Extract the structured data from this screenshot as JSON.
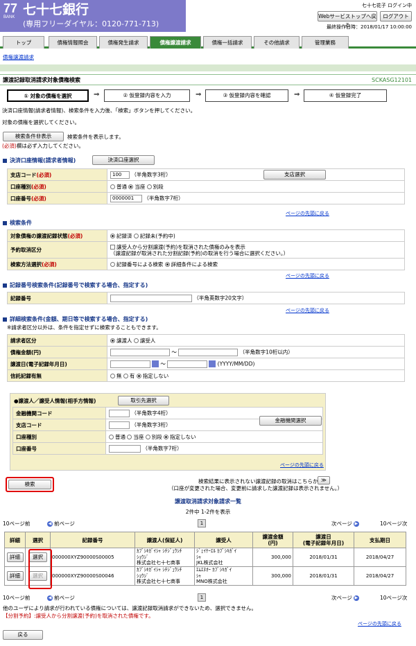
{
  "header": {
    "logo": "77",
    "logo_sub": "BANK",
    "bank_name": "七十七銀行",
    "free_dial": "(専用フリーダイヤル：0120-771-713)",
    "user": "七十七花子 ログイン中",
    "btn_top": "Webサービストップへ戻る",
    "btn_logout": "ログアウト",
    "last_op": "最終操作日時：2018/01/17 10:00:00"
  },
  "tabs": [
    "トップ",
    "債権情報照会",
    "債権発生請求",
    "債権譲渡請求",
    "債権一括請求",
    "その他請求",
    "管理業務"
  ],
  "subnav": "債権譲渡請求",
  "title": "譲渡記録取消請求対象債権検索",
  "title_code": "SCKASG12101",
  "steps": [
    "① 対象の債権を選択",
    "② 仮登録内容を入力",
    "③ 仮登録内容を確認",
    "④ 仮登録完了"
  ],
  "arrow": "⇒",
  "intro1": "決済口座情報(請求者情報)、検索条件を入力後、「検索」ボタンを押してください。",
  "intro2": "対象の債権を選択してください。",
  "btn_hide_cond": "検索条件非表示",
  "hide_cond_note": "検索条件を表示します。",
  "required_mark": "(必須)",
  "required_note": "欄は必ず入力してください。",
  "sec1": {
    "title": "決済口座情報(請求者情報)",
    "btn": "決済口座選択",
    "branch_lbl": "支店コード",
    "branch_val": "100",
    "branch_hint": "（半角数字3桁）",
    "branch_btn": "支店選択",
    "type_lbl": "口座種別",
    "type_opts": [
      "普通",
      "当座",
      "別段"
    ],
    "num_lbl": "口座番号",
    "num_val": "0000001",
    "num_hint": "（半角数字7桁）"
  },
  "pagetop": "ページの先頭に戻る",
  "sec2": {
    "title": "検索条件",
    "status_lbl": "対象債権の譲渡記録状態",
    "status_opts": [
      "記録済",
      "記録未(予約中)"
    ],
    "cancel_lbl": "予約取消区分",
    "cancel_text1": "譲受人から分割譲渡(予約)を取消された債権のみを表示",
    "cancel_text2": "（譲渡記録が取消された分割記録(予約)の取消を行う場合に選択ください。）",
    "method_lbl": "検索方法選択",
    "method_opts": [
      "記録番号による検索",
      "詳細条件による検索"
    ]
  },
  "sec3": {
    "title": "記録番号検索条件(記録番号で検索する場合、指定する)",
    "num_lbl": "記録番号",
    "num_hint": "（半角英数字20文字）"
  },
  "sec4": {
    "title": "詳細検索条件(金額、期日等で検索する場合、指定する)",
    "note": "※請求者区分以外は、条件を指定せずに検索することもできます。",
    "req_lbl": "請求者区分",
    "req_opts": [
      "譲渡人",
      "譲受人"
    ],
    "amt_lbl": "債権金額(円)",
    "amt_hint": "（半角数字10桁以内）",
    "tilde": "〜",
    "date_lbl": "譲渡日(電子記録年月日)",
    "date_hint": "(YYYY/MM/DD)",
    "trust_lbl": "信託記録有無",
    "trust_opts": [
      "無",
      "有",
      "指定しない"
    ],
    "inner_title": "●譲渡人／譲受人情報(相手方情報)",
    "inner_btn": "取引先選択",
    "bank_lbl": "金融機関コード",
    "bank_hint": "（半角数字4桁）",
    "bank_btn": "金融機関選択",
    "branch_lbl": "支店コード",
    "branch_hint": "（半角数字3桁）",
    "type_lbl": "口座種別",
    "type_opts": [
      "普通",
      "当座",
      "別段",
      "指定しない"
    ],
    "num_lbl": "口座番号",
    "num_hint": "（半角数字7桁）"
  },
  "btn_search": "検索",
  "search_note1": "検索結果に表示されない譲渡記録の取消はこちらから",
  "search_note2": "（口座が変更された場合、変更前に請求した譲渡記録は表示されません。）",
  "search_note_btn": "≫",
  "list_title": "譲渡取消請求対象請求一覧",
  "list_count": "2件中 1-2件を表示",
  "nav": {
    "prev10": "10ページ前",
    "prev": "前ページ",
    "page": "1",
    "next": "次ページ",
    "next10": "10ページ次"
  },
  "table": {
    "headers": [
      "詳細",
      "選択",
      "記録番号",
      "譲渡人(保証人)",
      "譲受人",
      "譲渡金額\n(円)",
      "譲渡日\n(電子記録年月日)",
      "支払期日"
    ],
    "btn_detail": "詳細",
    "btn_select": "選択",
    "rows": [
      {
        "rec": "000000XYZ90000S00005",
        "from1": "ｶﾌﾞｼｷｶﾞｲｼｬ ｼﾁｼﾞｭｳｼﾁ",
        "from2": "ｼｮｳｼﾞ",
        "from3": "株式会社七十七商事",
        "to1": "ｼﾞｪｲｹｰｴﾙ ｶﾌﾞｼｷｶﾞｲ",
        "to2": "ｼｬ",
        "to3": "JKL株式会社",
        "amt": "300,000",
        "date": "2018/01/31",
        "due": "2018/04/27"
      },
      {
        "rec": "000000XYZ90000S00046",
        "from1": "ｶﾌﾞｼｷｶﾞｲｼｬ ｼﾁｼﾞｭｳｼﾁ",
        "from2": "ｼｮｳｼﾞ",
        "from3": "株式会社七十七商事",
        "to1": "ｴﾑｴﾇｵｰ ｶﾌﾞｼｷｶﾞｲ",
        "to2": "ｼｬ",
        "to3": "MNO株式会社",
        "amt": "300,000",
        "date": "2018/01/31",
        "due": "2018/04/27"
      }
    ]
  },
  "foot1": "他のユーザにより請求が行われている債権については、譲渡記録取消請求ができないため、選択できません。",
  "foot2": "【分割予約】:譲受人から分割譲渡(予約)を取消された債権です。",
  "btn_back": "戻る"
}
